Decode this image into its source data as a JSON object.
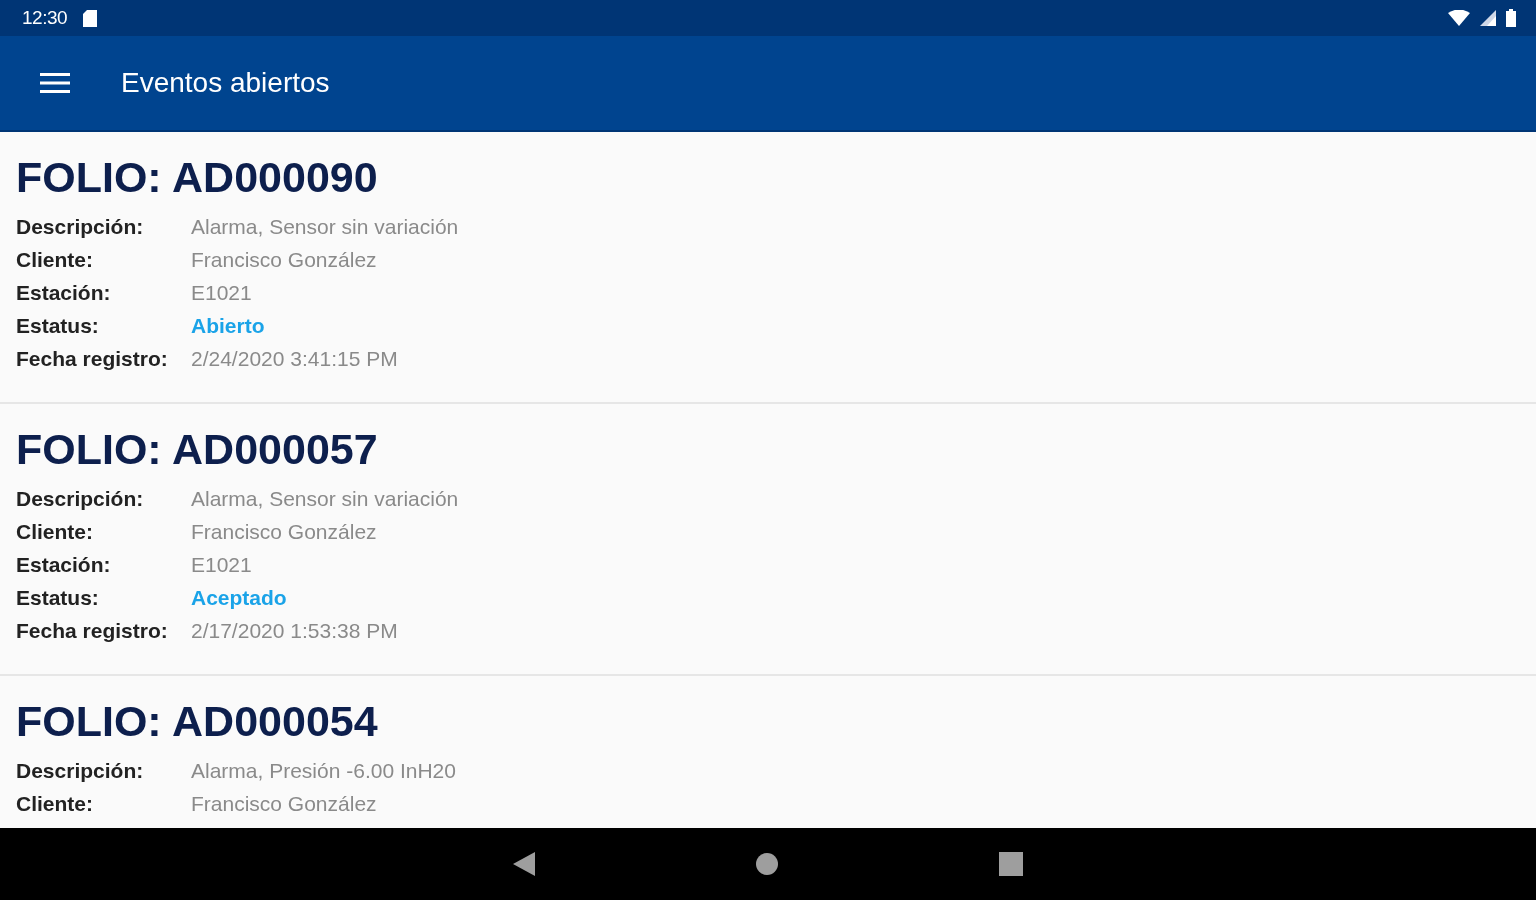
{
  "status_bar": {
    "time": "12:30"
  },
  "app_bar": {
    "title": "Eventos abiertos"
  },
  "events": [
    {
      "folio": "FOLIO: AD000090",
      "fields": [
        {
          "label": "Descripción:",
          "value": "Alarma, Sensor sin variación",
          "kind": "text"
        },
        {
          "label": "Cliente:",
          "value": "Francisco González",
          "kind": "text"
        },
        {
          "label": "Estación:",
          "value": "E1021",
          "kind": "text"
        },
        {
          "label": "Estatus:",
          "value": "Abierto",
          "kind": "status"
        },
        {
          "label": "Fecha registro:",
          "value": "2/24/2020 3:41:15 PM",
          "kind": "text"
        }
      ]
    },
    {
      "folio": "FOLIO: AD000057",
      "fields": [
        {
          "label": "Descripción:",
          "value": "Alarma, Sensor sin variación",
          "kind": "text"
        },
        {
          "label": "Cliente:",
          "value": "Francisco González",
          "kind": "text"
        },
        {
          "label": "Estación:",
          "value": "E1021",
          "kind": "text"
        },
        {
          "label": "Estatus:",
          "value": "Aceptado",
          "kind": "status"
        },
        {
          "label": "Fecha registro:",
          "value": "2/17/2020 1:53:38 PM",
          "kind": "text"
        }
      ]
    },
    {
      "folio": "FOLIO: AD000054",
      "fields": [
        {
          "label": "Descripción:",
          "value": "Alarma, Presión -6.00 InH20",
          "kind": "text"
        },
        {
          "label": "Cliente:",
          "value": "Francisco González",
          "kind": "text"
        }
      ]
    }
  ]
}
